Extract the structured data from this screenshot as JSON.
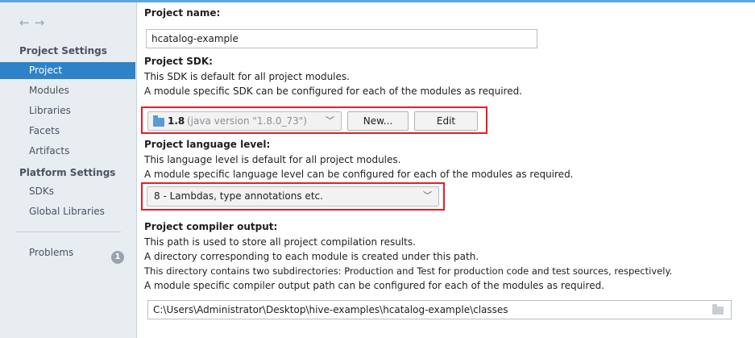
{
  "nav": {
    "back": "←",
    "forward": "→"
  },
  "sidebar": {
    "project_settings_title": "Project Settings",
    "project_settings_items": [
      "Project",
      "Modules",
      "Libraries",
      "Facets",
      "Artifacts"
    ],
    "selected": "Project",
    "platform_settings_title": "Platform Settings",
    "platform_settings_items": [
      "SDKs",
      "Global Libraries"
    ],
    "problems_label": "Problems",
    "problems_count": "1"
  },
  "main": {
    "project_name_label": "Project name:",
    "project_name_value": "hcatalog-example",
    "sdk_label": "Project SDK:",
    "sdk_desc_1": "This SDK is default for all project modules.",
    "sdk_desc_2": "A module specific SDK can be configured for each of the modules as required.",
    "sdk_value": "1.8",
    "sdk_version": "(java version \"1.8.0_73\")",
    "new_button": "New...",
    "edit_button": "Edit",
    "lang_label": "Project language level:",
    "lang_desc_1": "This language level is default for all project modules.",
    "lang_desc_2": "A module specific language level can be configured for each of the modules as required.",
    "lang_value": "8 - Lambdas, type annotations etc.",
    "output_label": "Project compiler output:",
    "output_desc_1": "This path is used to store all project compilation results.",
    "output_desc_2": "A directory corresponding to each module is created under this path.",
    "output_desc_3": "This directory contains two subdirectories: Production and Test for production code and test sources, respectively.",
    "output_desc_4": "A module specific compiler output path can be configured for each of the modules as required.",
    "output_path": "C:\\Users\\Administrator\\Desktop\\hive-examples\\hcatalog-example\\classes"
  },
  "colors": {
    "accent": "#2d82c8",
    "highlight": "#e21f26",
    "sidebar_bg": "#e8edf2"
  },
  "icons": {
    "back": "arrow-left-icon",
    "forward": "arrow-right-icon",
    "sdk": "jdk-folder-icon",
    "browse": "folder-icon",
    "dropdown": "chevron-down-icon"
  }
}
